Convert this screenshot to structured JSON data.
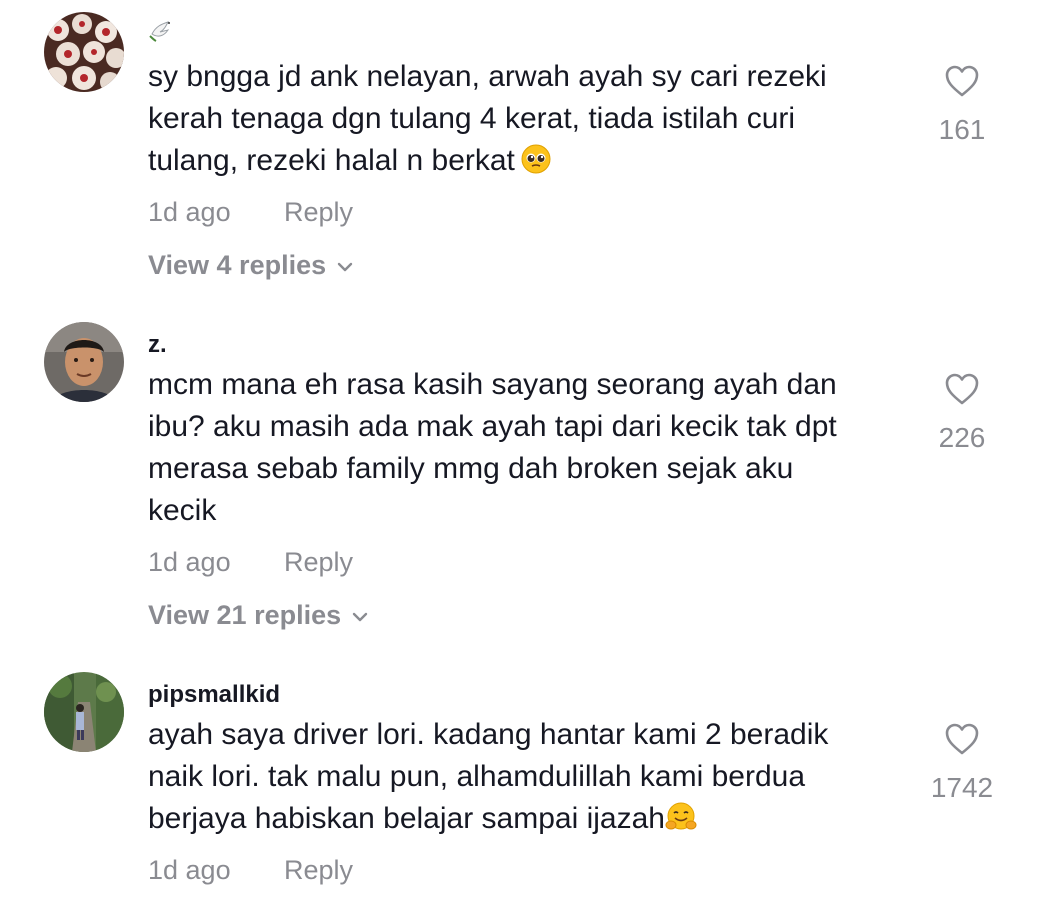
{
  "comments": [
    {
      "username": "",
      "username_icon": "dove-emoji-icon",
      "lines": [
        "sy bngga jd ank nelayan, arwah ayah sy cari rezeki",
        "kerah tenaga dgn tulang 4 kerat, tiada istilah curi",
        "tulang, rezeki halal n berkat"
      ],
      "trailing_emoji": "pleading-face-emoji-icon",
      "time": "1d ago",
      "reply_label": "Reply",
      "view_replies": "View 4 replies",
      "likes": "161"
    },
    {
      "username": "z.",
      "lines": [
        "mcm mana eh rasa kasih sayang seorang ayah dan",
        "ibu? aku masih ada mak ayah tapi dari kecik tak dpt",
        "merasa sebab family mmg dah broken sejak aku",
        "kecik"
      ],
      "time": "1d ago",
      "reply_label": "Reply",
      "view_replies": "View 21 replies",
      "likes": "226"
    },
    {
      "username": "pipsmallkid",
      "lines": [
        "ayah saya driver lori. kadang hantar kami 2 beradik",
        "naik lori. tak malu pun, alhamdulillah kami berdua",
        "berjaya habiskan belajar sampai ijazah"
      ],
      "trailing_emoji": "hugging-face-emoji-icon",
      "time": "1d ago",
      "reply_label": "Reply",
      "likes": "1742"
    }
  ],
  "colors": {
    "text": "#161823",
    "muted": "#8a8b91"
  }
}
